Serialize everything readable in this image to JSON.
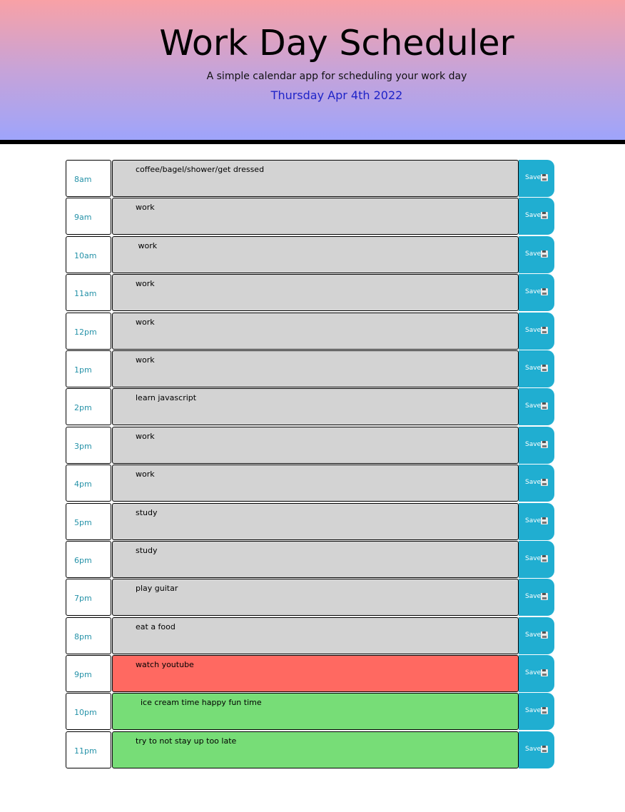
{
  "header": {
    "title": "Work Day Scheduler",
    "subtitle": "A simple calendar app for scheduling your work day",
    "current_day": "Thursday Apr 4th 2022"
  },
  "colors": {
    "past": "#d3d3d3",
    "present": "#ff6961",
    "future": "#77dd77",
    "save": "#20aed1",
    "hour_text": "#2592a8",
    "current_day_text": "#1f24c8"
  },
  "save_label": "Save",
  "save_icon": "floppy-disk-icon",
  "rows": [
    {
      "hour": "8am",
      "text": "coffee/bagel/shower/get dressed",
      "state": "past"
    },
    {
      "hour": "9am",
      "text": "work",
      "state": "past"
    },
    {
      "hour": "10am",
      "text": " work",
      "state": "past"
    },
    {
      "hour": "11am",
      "text": "work",
      "state": "past"
    },
    {
      "hour": "12pm",
      "text": "work",
      "state": "past"
    },
    {
      "hour": "1pm",
      "text": "work",
      "state": "past"
    },
    {
      "hour": "2pm",
      "text": "learn javascript",
      "state": "past"
    },
    {
      "hour": "3pm",
      "text": "work",
      "state": "past"
    },
    {
      "hour": "4pm",
      "text": "work",
      "state": "past"
    },
    {
      "hour": "5pm",
      "text": "study",
      "state": "past"
    },
    {
      "hour": "6pm",
      "text": "study",
      "state": "past"
    },
    {
      "hour": "7pm",
      "text": "play guitar",
      "state": "past"
    },
    {
      "hour": "8pm",
      "text": "eat a food",
      "state": "past"
    },
    {
      "hour": "9pm",
      "text": "watch youtube",
      "state": "present"
    },
    {
      "hour": "10pm",
      "text": "  ice cream time happy fun time",
      "state": "future"
    },
    {
      "hour": "11pm",
      "text": "try to not stay up too late",
      "state": "future"
    }
  ]
}
